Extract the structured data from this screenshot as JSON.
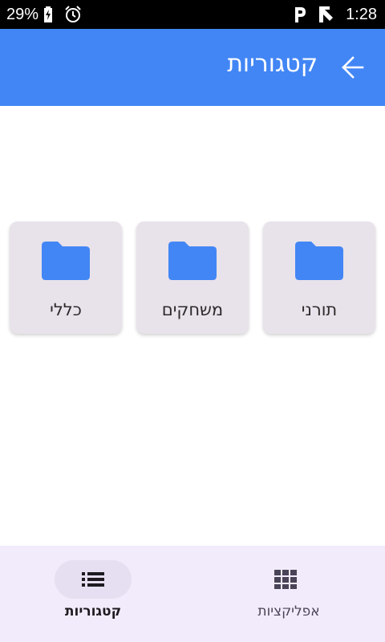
{
  "status_bar": {
    "battery": "29%",
    "time": "1:28",
    "icons": [
      "battery-charging-icon",
      "alarm-icon",
      "parking-icon",
      "media-icon"
    ]
  },
  "app_bar": {
    "title": "קטגוריות",
    "back_icon": "arrow-back-icon"
  },
  "categories": [
    {
      "label": "תורני",
      "icon": "folder-icon"
    },
    {
      "label": "משחקים",
      "icon": "folder-icon"
    },
    {
      "label": "כללי",
      "icon": "folder-icon"
    }
  ],
  "bottom_nav": {
    "items": [
      {
        "label": "אפליקציות",
        "icon": "apps-grid-icon",
        "selected": false
      },
      {
        "label": "קטגוריות",
        "icon": "list-icon",
        "selected": true
      }
    ]
  },
  "colors": {
    "app_bar": "#4286f5",
    "folder": "#4286f5",
    "card_bg": "#e8e2ea",
    "bottom_nav_bg": "#f2ebfb",
    "nav_selected_pill": "#e6dff1"
  }
}
